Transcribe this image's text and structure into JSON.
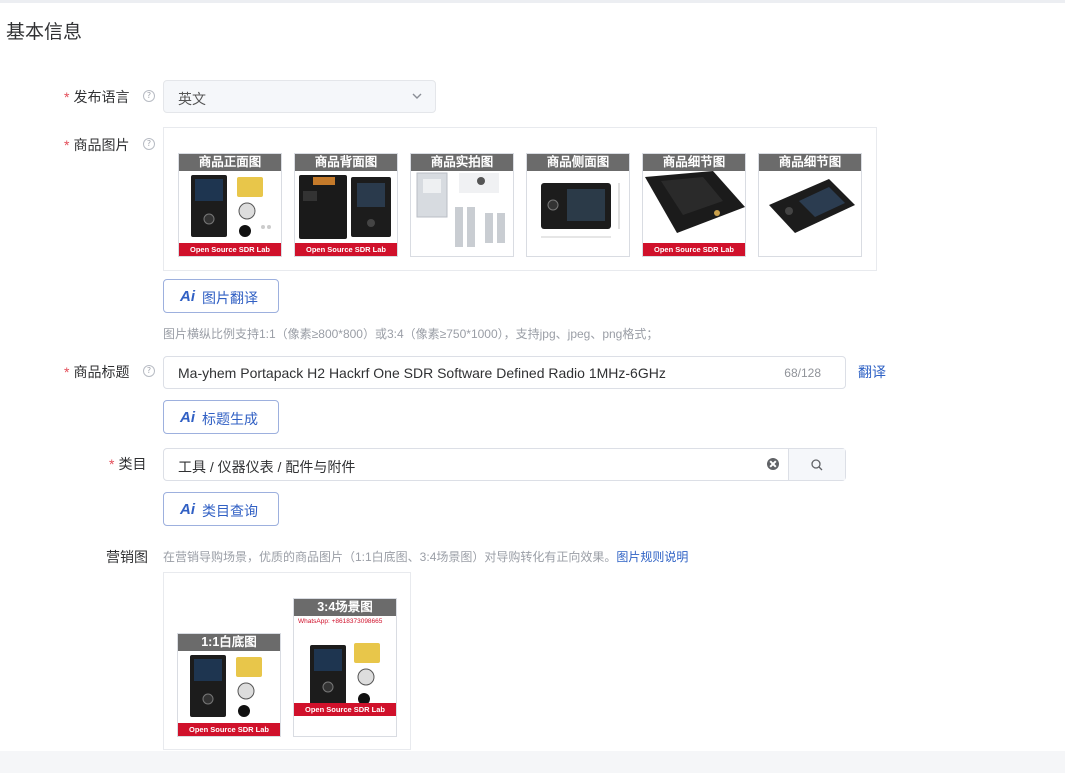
{
  "section": {
    "title": "基本信息"
  },
  "required_mark": "*",
  "help_glyph": "?",
  "ai_glyph": "Ai",
  "language": {
    "label": "发布语言",
    "value": "英文"
  },
  "images": {
    "label": "商品图片",
    "items": [
      {
        "caption": "商品正面图",
        "footer": "Open Source SDR Lab"
      },
      {
        "caption": "商品背面图",
        "footer": "Open Source SDR Lab"
      },
      {
        "caption": "商品实拍图",
        "footer": ""
      },
      {
        "caption": "商品侧面图",
        "footer": ""
      },
      {
        "caption": "商品细节图",
        "footer": "Open Source SDR Lab"
      },
      {
        "caption": "商品细节图",
        "footer": ""
      }
    ],
    "ai_button": "图片翻译",
    "hint": "图片横纵比例支持1:1（像素≥800*800）或3:4（像素≥750*1000），支持jpg、jpeg、png格式；"
  },
  "title_field": {
    "label": "商品标题",
    "value": "Ma-yhem Portapack H2 Hackrf One SDR Software Defined Radio 1MHz-6GHz",
    "count": "68/128",
    "translate": "翻译",
    "ai_button": "标题生成"
  },
  "category": {
    "label": "类目",
    "value": "工具 / 仪器仪表 / 配件与附件",
    "ai_button": "类目查询"
  },
  "marketing": {
    "label": "营销图",
    "hint": "在营销导购场景，优质的商品图片（1:1白底图、3:4场景图）对导购转化有正向效果。",
    "link": "图片规则说明",
    "items": [
      {
        "caption": "1:1白底图",
        "footer": "Open Source SDR Lab"
      },
      {
        "caption": "3:4场景图",
        "footer": "Open Source SDR Lab",
        "contact": "WhatsApp: +8618373098665"
      }
    ]
  },
  "colors": {
    "accent": "#2f62c5",
    "required": "#e34d59",
    "brand_red": "#d0112b"
  }
}
